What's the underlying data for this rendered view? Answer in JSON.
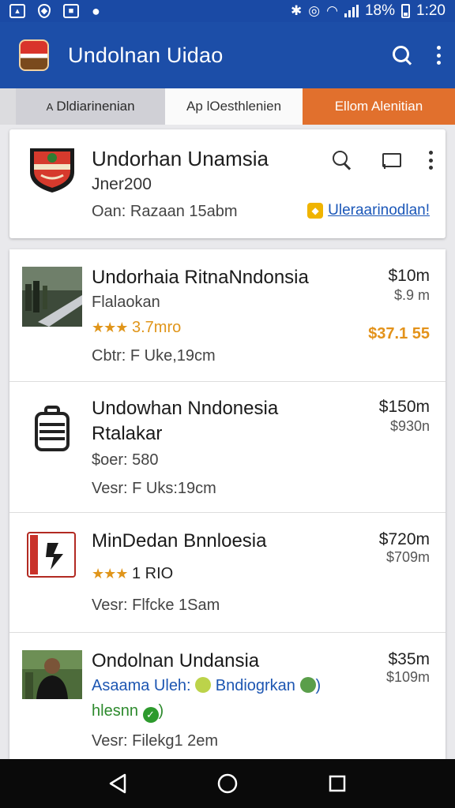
{
  "status_bar": {
    "battery_percent": "18%",
    "time": "1:20",
    "icons": [
      "gallery-icon",
      "shield-icon",
      "app-icon",
      "location-icon",
      "bluetooth-icon",
      "alarm-icon",
      "wifi-icon",
      "signal-icon",
      "battery-icon"
    ]
  },
  "app_bar": {
    "title": "Undolnan Uidao"
  },
  "tabs": [
    {
      "label": "Dldiarinenian",
      "prefix": "A"
    },
    {
      "label": "Ap lOesthlenien"
    },
    {
      "label": "Ellom Alenitian"
    }
  ],
  "header_card": {
    "title": "Undorhan Unamsia",
    "subtitle": "Jner200",
    "meta": "Oan: Razaan 15abm",
    "link": "Uleraarinodlan!"
  },
  "items": [
    {
      "title": "Undorhaia RitnaNndonsia",
      "line2": "Flalaokan",
      "stars": "★★★",
      "rating": "3.7mro",
      "line4": "Cbtr: F Uke,19cm",
      "price": "$10m",
      "price_sub": "$.9 m",
      "price_highlight": "$37.1 55"
    },
    {
      "title": "Undowhan Nndonesia",
      "line2": "Rtalakar",
      "line3": "$oer: 580",
      "line4": "Vesr: F Uks:19cm",
      "price": "$150m",
      "price_sub": "$930n"
    },
    {
      "title": "MinDedan Bnnloesia",
      "stars": "★★★",
      "rating": "1 RIO",
      "line4": "Vesr: Flfcke 1Sam",
      "price": "$720m",
      "price_sub": "$709m"
    },
    {
      "title": "Ondolnan Undansia",
      "line2_a": "Asaama Uleh:",
      "line2_b": "Bndiogrkan",
      "line3": "hlesnn",
      "line4": "Vesr: Filekg1 2em",
      "price": "$35m",
      "price_sub": "$109m"
    }
  ],
  "colors": {
    "app_bar": "#1c4ea8",
    "accent_tab": "#e1702d",
    "rating": "#e0951a",
    "link": "#1b57b8"
  }
}
